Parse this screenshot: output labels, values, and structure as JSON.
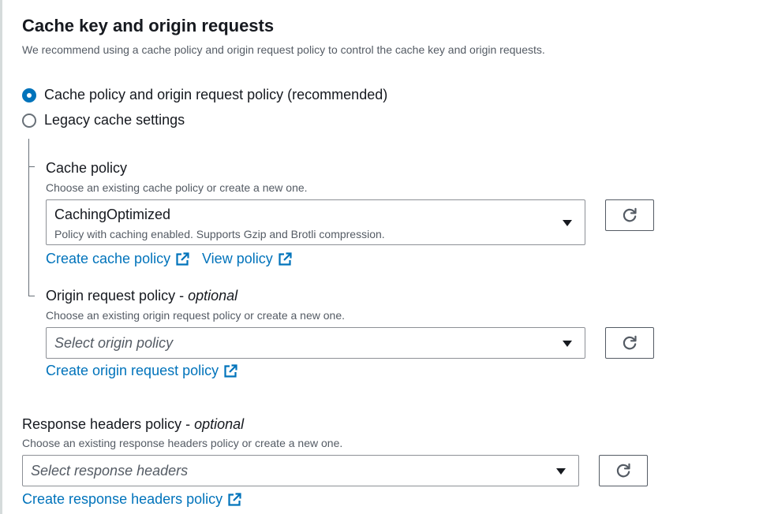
{
  "section": {
    "title": "Cache key and origin requests",
    "description": "We recommend using a cache policy and origin request policy to control the cache key and origin requests."
  },
  "options": [
    {
      "label": "Cache policy and origin request policy (recommended)",
      "selected": true
    },
    {
      "label": "Legacy cache settings",
      "selected": false
    }
  ],
  "cache_policy": {
    "label": "Cache policy",
    "description": "Choose an existing cache policy or create a new one.",
    "selected_value": "CachingOptimized",
    "selected_description": "Policy with caching enabled. Supports Gzip and Brotli compression.",
    "create_link": "Create cache policy",
    "view_link": "View policy"
  },
  "origin_request_policy": {
    "label": "Origin request policy",
    "optional": "optional",
    "description": "Choose an existing origin request policy or create a new one.",
    "placeholder": "Select origin policy",
    "create_link": "Create origin request policy"
  },
  "response_headers_policy": {
    "label": "Response headers policy",
    "optional": "optional",
    "description": "Choose an existing response headers policy or create a new one.",
    "placeholder": "Select response headers",
    "create_link": "Create response headers policy"
  },
  "colors": {
    "link": "#0073bb",
    "radio_selected": "#0073bb",
    "text": "#16191f",
    "secondary_text": "#545b64",
    "border": "#8d9096"
  },
  "icons": {
    "refresh": "refresh-icon",
    "external": "external-link-icon",
    "caret": "caret-down-icon"
  }
}
